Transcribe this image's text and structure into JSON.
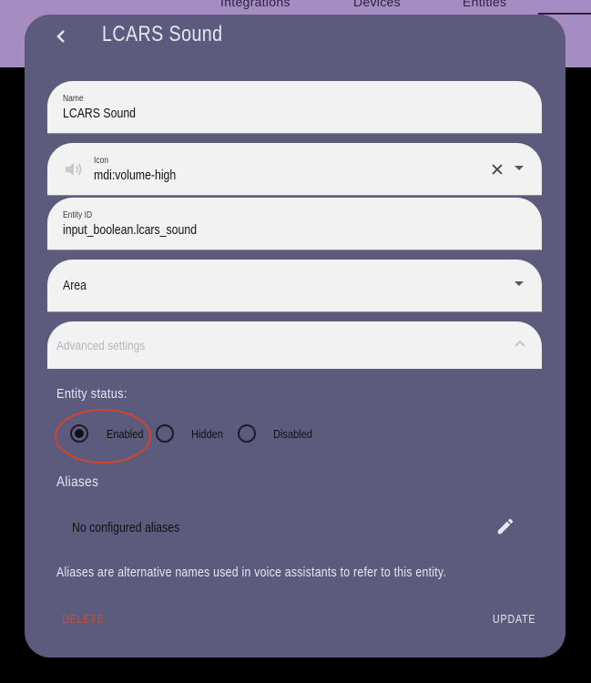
{
  "topnav": {
    "tabs": [
      "Integrations",
      "Devices",
      "Entities"
    ]
  },
  "dialog": {
    "title": "LCARS Sound",
    "name_field": {
      "label": "Name",
      "value": "LCARS Sound"
    },
    "icon_field": {
      "label": "Icon",
      "value": "mdi:volume-high",
      "icon": "volume-high-icon"
    },
    "entity_id_field": {
      "label": "Entity ID",
      "value": "input_boolean.lcars_sound"
    },
    "area_field": {
      "label": "Area"
    },
    "advanced": {
      "label": "Advanced settings"
    },
    "entity_status": {
      "label": "Entity status:",
      "options": [
        "Enabled",
        "Hidden",
        "Disabled"
      ],
      "selected": "Enabled"
    },
    "aliases": {
      "heading": "Aliases",
      "empty_text": "No configured aliases",
      "help": "Aliases are alternative names used in voice assistants to refer to this entity."
    },
    "buttons": {
      "delete": "DELETE",
      "update": "UPDATE"
    }
  },
  "colors": {
    "dialog_bg": "#5c5b7d",
    "topbar_bg": "#a58dc1",
    "field_bg": "#f2f2f2",
    "delete": "#c0513f",
    "highlight_ring": "#d4442a"
  }
}
